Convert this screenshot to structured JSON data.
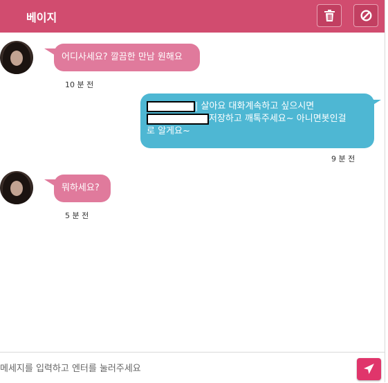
{
  "header": {
    "title": "베이지",
    "trash_icon": "trash-icon",
    "block_icon": "block-icon"
  },
  "messages": [
    {
      "side": "left",
      "text": "어디사세요? 깔끔한 만남 원해요",
      "time": "10 분 전"
    },
    {
      "side": "right",
      "line1_after_redaction": "| 살아요 대화계속하고 싶으시면",
      "line2_after_redaction": "저장하고 깨톡주세요~ 아니면봇인걸",
      "line3": "로 알게요~",
      "time": "9 분 전"
    },
    {
      "side": "left",
      "text": "뭐하세요?",
      "time": "5 분 전"
    }
  ],
  "composer": {
    "placeholder": "메세지를 입력하고 엔터를 눌러주세요",
    "send_icon": "send-icon"
  },
  "colors": {
    "header": "#d14c6f",
    "incoming_bubble": "#e07a9c",
    "outgoing_bubble": "#4eb7d3",
    "send_button": "#e0356b"
  }
}
